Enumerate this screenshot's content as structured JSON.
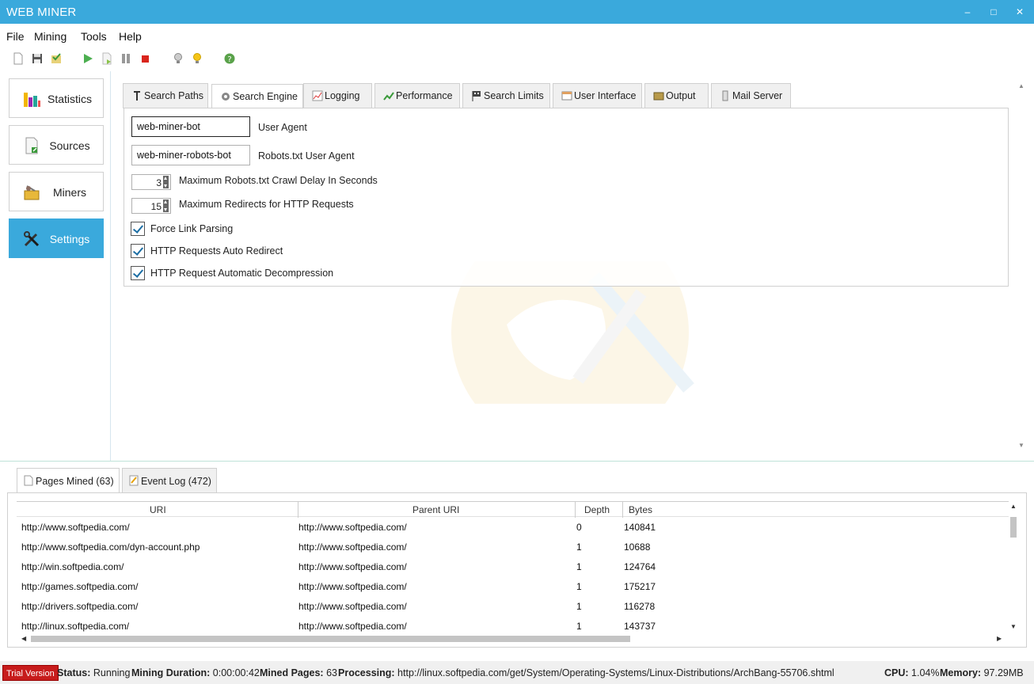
{
  "window": {
    "title": "WEB MINER",
    "minimize": "–",
    "maximize": "□",
    "close": "✕"
  },
  "menu": [
    "File",
    "Mining",
    "Tools",
    "Help"
  ],
  "toolbar_icons": [
    "new-icon",
    "save-icon",
    "check-icon",
    "play-icon",
    "step-icon",
    "pause-icon",
    "stop-icon",
    "bulb-off-icon",
    "bulb-on-icon",
    "help-icon"
  ],
  "nav": [
    {
      "label": "Statistics",
      "icon": "chart-icon"
    },
    {
      "label": "Sources",
      "icon": "document-icon"
    },
    {
      "label": "Miners",
      "icon": "miner-icon"
    },
    {
      "label": "Settings",
      "icon": "tools-icon",
      "active": true
    }
  ],
  "tabs": [
    {
      "label": "Search Paths"
    },
    {
      "label": "Search Engine",
      "active": true
    },
    {
      "label": "Logging"
    },
    {
      "label": "Performance"
    },
    {
      "label": "Search Limits"
    },
    {
      "label": "User Interface"
    },
    {
      "label": "Output"
    },
    {
      "label": "Mail Server"
    }
  ],
  "search_engine": {
    "user_agent": {
      "value": "web-miner-bot",
      "label": "User Agent"
    },
    "robots_agent": {
      "value": "web-miner-robots-bot",
      "label": "Robots.txt User Agent"
    },
    "crawl_delay": {
      "value": "3",
      "label": "Maximum Robots.txt Crawl Delay In Seconds"
    },
    "max_redirects": {
      "value": "15",
      "label": "Maximum Redirects for HTTP Requests"
    },
    "force_link_parsing": {
      "checked": true,
      "label": "Force Link Parsing"
    },
    "auto_redirect": {
      "checked": true,
      "label": "HTTP Requests Auto Redirect"
    },
    "auto_decompress": {
      "checked": true,
      "label": "HTTP Request Automatic Decompression"
    }
  },
  "bottom_tabs": [
    {
      "label": "Pages Mined (63)",
      "active": true
    },
    {
      "label": "Event Log (472)"
    }
  ],
  "grid": {
    "columns": [
      "URI",
      "Parent URI",
      "Depth",
      "Bytes"
    ],
    "rows": [
      [
        "http://www.softpedia.com/",
        "http://www.softpedia.com/",
        "0",
        "140841"
      ],
      [
        "http://www.softpedia.com/dyn-account.php",
        "http://www.softpedia.com/",
        "1",
        "10688"
      ],
      [
        "http://win.softpedia.com/",
        "http://www.softpedia.com/",
        "1",
        "124764"
      ],
      [
        "http://games.softpedia.com/",
        "http://www.softpedia.com/",
        "1",
        "175217"
      ],
      [
        "http://drivers.softpedia.com/",
        "http://www.softpedia.com/",
        "1",
        "116278"
      ],
      [
        "http://linux.softpedia.com/",
        "http://www.softpedia.com/",
        "1",
        "143737"
      ]
    ]
  },
  "status": {
    "trial": "Trial Version",
    "status_label": "Status:",
    "status_value": "Running",
    "duration_label": "Mining Duration:",
    "duration_value": "0:00:00:42",
    "pages_label": "Mined Pages:",
    "pages_value": "63",
    "processing_label": "Processing:",
    "processing_value": "http://linux.softpedia.com/get/System/Operating-Systems/Linux-Distributions/ArchBang-55706.shtml",
    "cpu_label": "CPU:",
    "cpu_value": "1.04%",
    "memory_label": "Memory:",
    "memory_value": "97.29MB"
  },
  "colors": {
    "accent": "#3aa9dc",
    "trial": "#c71c1c"
  }
}
